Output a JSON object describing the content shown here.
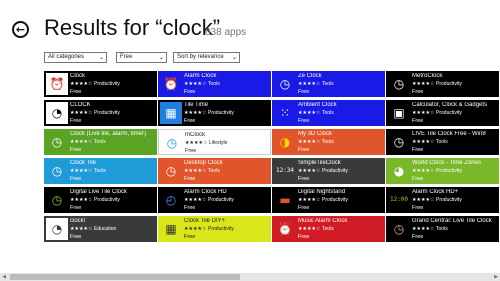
{
  "header": {
    "title": "Results for “clock”",
    "count": "638 apps",
    "back_glyph": "←"
  },
  "filters": [
    {
      "label": "All categories"
    },
    {
      "label": "Free"
    },
    {
      "label": "Sort by relevance"
    }
  ],
  "chevron_glyph": "⌄",
  "columns": [
    [
      {
        "name": "Clock",
        "stars": "★★★★☆",
        "category": "Productivity",
        "price": "Free",
        "bg": "#000000",
        "fg": "#ffffff",
        "icon": "alarm-clock-icon",
        "glyph": "⏰",
        "icon_bg": "#ffffff",
        "icon_fg": "#000000"
      },
      {
        "name": "CLOCK",
        "stars": "★★★★☆",
        "category": "Productivity",
        "price": "Free",
        "bg": "#000000",
        "fg": "#ffffff",
        "icon": "clock-face-icon",
        "glyph": "◔",
        "icon_bg": "#ffffff",
        "icon_fg": "#000000"
      },
      {
        "name": "Clock (Live tile, alarm, timer)",
        "stars": "★★★★☆",
        "category": "Tools",
        "price": "Free",
        "bg": "#5aa325",
        "fg": "#ffffff",
        "icon": "clock-icon",
        "glyph": "◷",
        "icon_bg": "#5aa325",
        "icon_fg": "#ffffff"
      },
      {
        "name": "Clock Tile",
        "stars": "★★★★☆",
        "category": "Tools",
        "price": "Free",
        "bg": "#1f9cd8",
        "fg": "#ffffff",
        "icon": "clock-icon",
        "glyph": "◷",
        "icon_bg": "#1f9cd8",
        "icon_fg": "#ffffff"
      },
      {
        "name": "Digital Live Tile Clock",
        "stars": "★★★★☆",
        "category": "Productivity",
        "price": "Free",
        "bg": "#000000",
        "fg": "#ffffff",
        "icon": "digital-clock-icon",
        "glyph": "◷",
        "icon_bg": "#000000",
        "icon_fg": "#8bd12b"
      },
      {
        "name": "clock!",
        "stars": "★★★★☆",
        "category": "Education",
        "price": "Free",
        "bg": "#3a3a3a",
        "fg": "#ffffff",
        "icon": "clock-logo-icon",
        "glyph": "◔",
        "icon_bg": "#ffffff",
        "icon_fg": "#333333"
      }
    ],
    [
      {
        "name": "Alarm Clock",
        "stars": "★★★★☆",
        "category": "Tools",
        "price": "Free",
        "bg": "#1a1ae6",
        "fg": "#ffffff",
        "icon": "alarm-clock-icon",
        "glyph": "⏰",
        "icon_bg": "#1a1ae6",
        "icon_fg": "#ffffff"
      },
      {
        "name": "Tile Time",
        "stars": "★★★★☆",
        "category": "Productivity",
        "price": "Free",
        "bg": "#000000",
        "fg": "#ffffff",
        "icon": "tile-time-icon",
        "glyph": "▦",
        "icon_bg": "#1f7fe0",
        "icon_fg": "#ffffff"
      },
      {
        "name": "mClock",
        "stars": "★★★★☆",
        "category": "Lifestyle",
        "price": "Free",
        "bg": "#ffffff",
        "fg": "#222222",
        "icon": "clock-icon",
        "glyph": "◷",
        "icon_bg": "#ffffff",
        "icon_fg": "#1aa3d6"
      },
      {
        "name": "Desktop Clock",
        "stars": "★★★★☆",
        "category": "Tools",
        "price": "Free",
        "bg": "#e0562a",
        "fg": "#ffffff",
        "icon": "clock-icon",
        "glyph": "◷",
        "icon_bg": "#e0562a",
        "icon_fg": "#ffffff"
      },
      {
        "name": "Alarm Clock HD",
        "stars": "★★★★☆",
        "category": "Productivity",
        "price": "Free",
        "bg": "#000000",
        "fg": "#ffffff",
        "icon": "clock-face-icon",
        "glyph": "◴",
        "icon_bg": "#000000",
        "icon_fg": "#4a90ff"
      },
      {
        "name": "Clock Tile DIY+",
        "stars": "★★★★☆",
        "category": "Productivity",
        "price": "Free",
        "bg": "#d8e61a",
        "fg": "#222222",
        "icon": "tile-grid-icon",
        "glyph": "▦",
        "icon_bg": "#d8e61a",
        "icon_fg": "#333333"
      }
    ],
    [
      {
        "name": "Ze Clock",
        "stars": "★★★★☆",
        "category": "Tools",
        "price": "Free",
        "bg": "#1a1ae6",
        "fg": "#ffffff",
        "icon": "clock-icon",
        "glyph": "◷",
        "icon_bg": "#1a1ae6",
        "icon_fg": "#ffffff"
      },
      {
        "name": "Ambient Clock",
        "stars": "★★★★☆",
        "category": "Tools",
        "price": "Free",
        "bg": "#1a1ae6",
        "fg": "#ffffff",
        "icon": "dots-icon",
        "glyph": "⁙",
        "icon_bg": "#1a1ae6",
        "icon_fg": "#ffffff"
      },
      {
        "name": "My 3D Clock",
        "stars": "★★★★☆",
        "category": "Tools",
        "price": "Free",
        "bg": "#e0562a",
        "fg": "#ffffff",
        "icon": "3d-clock-icon",
        "glyph": "◑",
        "icon_bg": "#e0562a",
        "icon_fg": "#ffd400"
      },
      {
        "name": "SimpleTileClock",
        "stars": "★★★★☆",
        "category": "Productivity",
        "price": "Free",
        "bg": "#3a3a3a",
        "fg": "#ffffff",
        "icon": "digital-clock-icon",
        "glyph": "12:34",
        "icon_bg": "#3a3a3a",
        "icon_fg": "#ffffff"
      },
      {
        "name": "Digital Nightstand",
        "stars": "★★★★☆",
        "category": "Productivity",
        "price": "Free",
        "bg": "#000000",
        "fg": "#ffffff",
        "icon": "nightstand-icon",
        "glyph": "▬",
        "icon_bg": "#000000",
        "icon_fg": "#e0562a"
      },
      {
        "name": "Music Alarm Clock",
        "stars": "★★★★☆",
        "category": "Tools",
        "price": "Free",
        "bg": "#d01c24",
        "fg": "#ffffff",
        "icon": "alarm-clock-icon",
        "glyph": "⏰",
        "icon_bg": "#d01c24",
        "icon_fg": "#ffffff"
      }
    ],
    [
      {
        "name": "MetroClock",
        "stars": "★★★★☆",
        "category": "Productivity",
        "price": "Free",
        "bg": "#000000",
        "fg": "#ffffff",
        "icon": "metro-clock-icon",
        "glyph": "◷",
        "icon_bg": "#000000",
        "icon_fg": "#ffffff"
      },
      {
        "name": "Calculator, Clock & Gadgets",
        "stars": "★★★★☆",
        "category": "Productivity",
        "price": "Free",
        "bg": "#000000",
        "fg": "#ffffff",
        "icon": "calculator-icon",
        "glyph": "▣",
        "icon_bg": "#000000",
        "icon_fg": "#ffffff"
      },
      {
        "name": "LIVE Tile Clock Free - Win8",
        "stars": "★★★★☆",
        "category": "Tools",
        "price": "Free",
        "bg": "#000000",
        "fg": "#ffffff",
        "icon": "clock-face-icon",
        "glyph": "◷",
        "icon_bg": "#000000",
        "icon_fg": "#ffffff"
      },
      {
        "name": "World Clock - Time Zones",
        "stars": "★★★★☆",
        "category": "Productivity",
        "price": "Free",
        "bg": "#7ab82a",
        "fg": "#ffffff",
        "icon": "globe-clock-icon",
        "glyph": "◕",
        "icon_bg": "#7ab82a",
        "icon_fg": "#ffffff"
      },
      {
        "name": "Alarm Clock HD+",
        "stars": "★★★★☆",
        "category": "Productivity",
        "price": "Free",
        "bg": "#000000",
        "fg": "#ffffff",
        "icon": "digital-clock-icon",
        "glyph": "12:00",
        "icon_bg": "#000000",
        "icon_fg": "#8bd12b"
      },
      {
        "name": "Grand Central: Live Tile Clock",
        "stars": "★★★★☆",
        "category": "Tools",
        "price": "Free",
        "bg": "#000000",
        "fg": "#ffffff",
        "icon": "clock-face-icon",
        "glyph": "◷",
        "icon_bg": "#000000",
        "icon_fg": "#e0a0a0"
      }
    ]
  ],
  "scroll": {
    "left_glyph": "◀",
    "right_glyph": "▶"
  }
}
